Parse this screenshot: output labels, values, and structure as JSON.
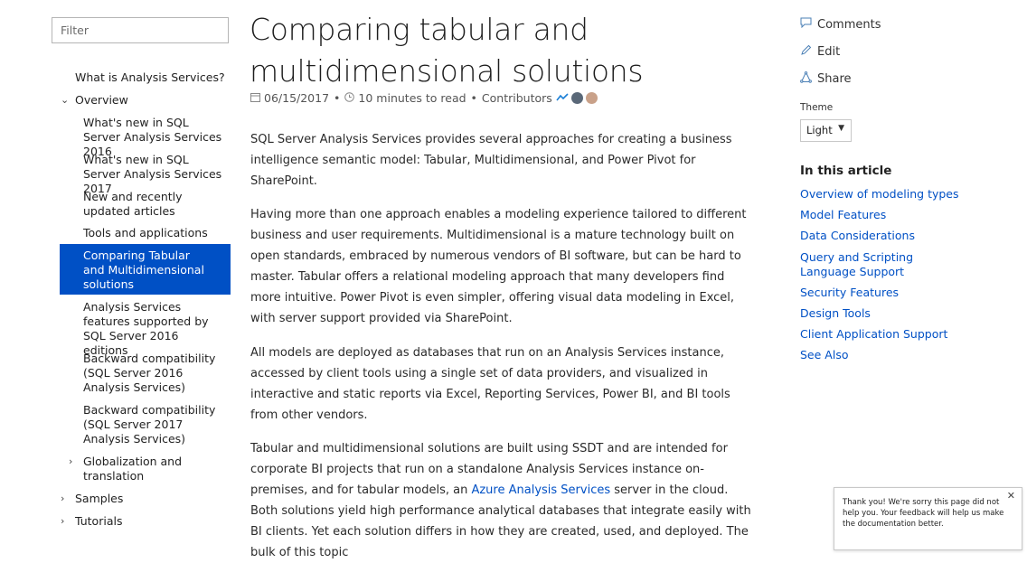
{
  "filter": {
    "placeholder": "Filter"
  },
  "nav": {
    "items": [
      {
        "label": "What is Analysis Services?"
      },
      {
        "label": "Overview"
      },
      {
        "label": "What's new in SQL Server Analysis Services 2016"
      },
      {
        "label": "What's new in SQL Server Analysis Services 2017"
      },
      {
        "label": "New and recently updated articles"
      },
      {
        "label": "Tools and applications"
      },
      {
        "label": "Comparing Tabular and Multidimensional solutions"
      },
      {
        "label": "Analysis Services features supported by SQL Server 2016 editions"
      },
      {
        "label": "Backward compatibility (SQL Server 2016 Analysis Services)"
      },
      {
        "label": "Backward compatibility (SQL Server 2017 Analysis Services)"
      },
      {
        "label": "Globalization and translation"
      },
      {
        "label": "Samples"
      },
      {
        "label": "Tutorials"
      }
    ]
  },
  "article": {
    "title": "Comparing tabular and multidimensional solutions",
    "date": "06/15/2017",
    "read_time": "10 minutes to read",
    "contributors_label": "Contributors",
    "p1": "SQL Server Analysis Services provides several approaches for creating a business intelligence semantic model: Tabular, Multidimensional, and Power Pivot for SharePoint.",
    "p2": "Having more than one approach enables a modeling experience tailored to different business and user requirements. Multidimensional is a mature technology built on open standards, embraced by numerous vendors of BI software, but can be hard to master. Tabular offers a relational modeling approach that many developers find more intuitive. Power Pivot is even simpler, offering visual data modeling in Excel, with server support provided via SharePoint.",
    "p3": "All models are deployed as databases that run on an Analysis Services instance, accessed by client tools using a single set of data providers, and visualized in interactive and static reports via Excel, Reporting Services, Power BI, and BI tools from other vendors.",
    "p4_before": "Tabular and multidimensional solutions are built using SSDT and are intended for corporate BI projects that run on a standalone Analysis Services instance on-premises, and for tabular models, an ",
    "p4_link": "Azure Analysis Services",
    "p4_after": " server in the cloud. Both solutions yield high performance analytical databases that integrate easily with BI clients. Yet each solution differs in how they are created, used, and deployed. The bulk of this topic"
  },
  "rail": {
    "comments": "Comments",
    "edit": "Edit",
    "share": "Share",
    "theme_label": "Theme",
    "theme_value": "Light",
    "in_this_article": "In this article",
    "toc": [
      "Overview of modeling types",
      "Model Features",
      "Data Considerations",
      "Query and Scripting Language Support",
      "Security Features",
      "Design Tools",
      "Client Application Support",
      "See Also"
    ]
  },
  "feedback": {
    "text": "Thank you! We're sorry this page did not help you. Your feedback will help us make the documentation better."
  },
  "colors": {
    "accent": "#0050c5",
    "selected_bg": "#0050c5"
  }
}
